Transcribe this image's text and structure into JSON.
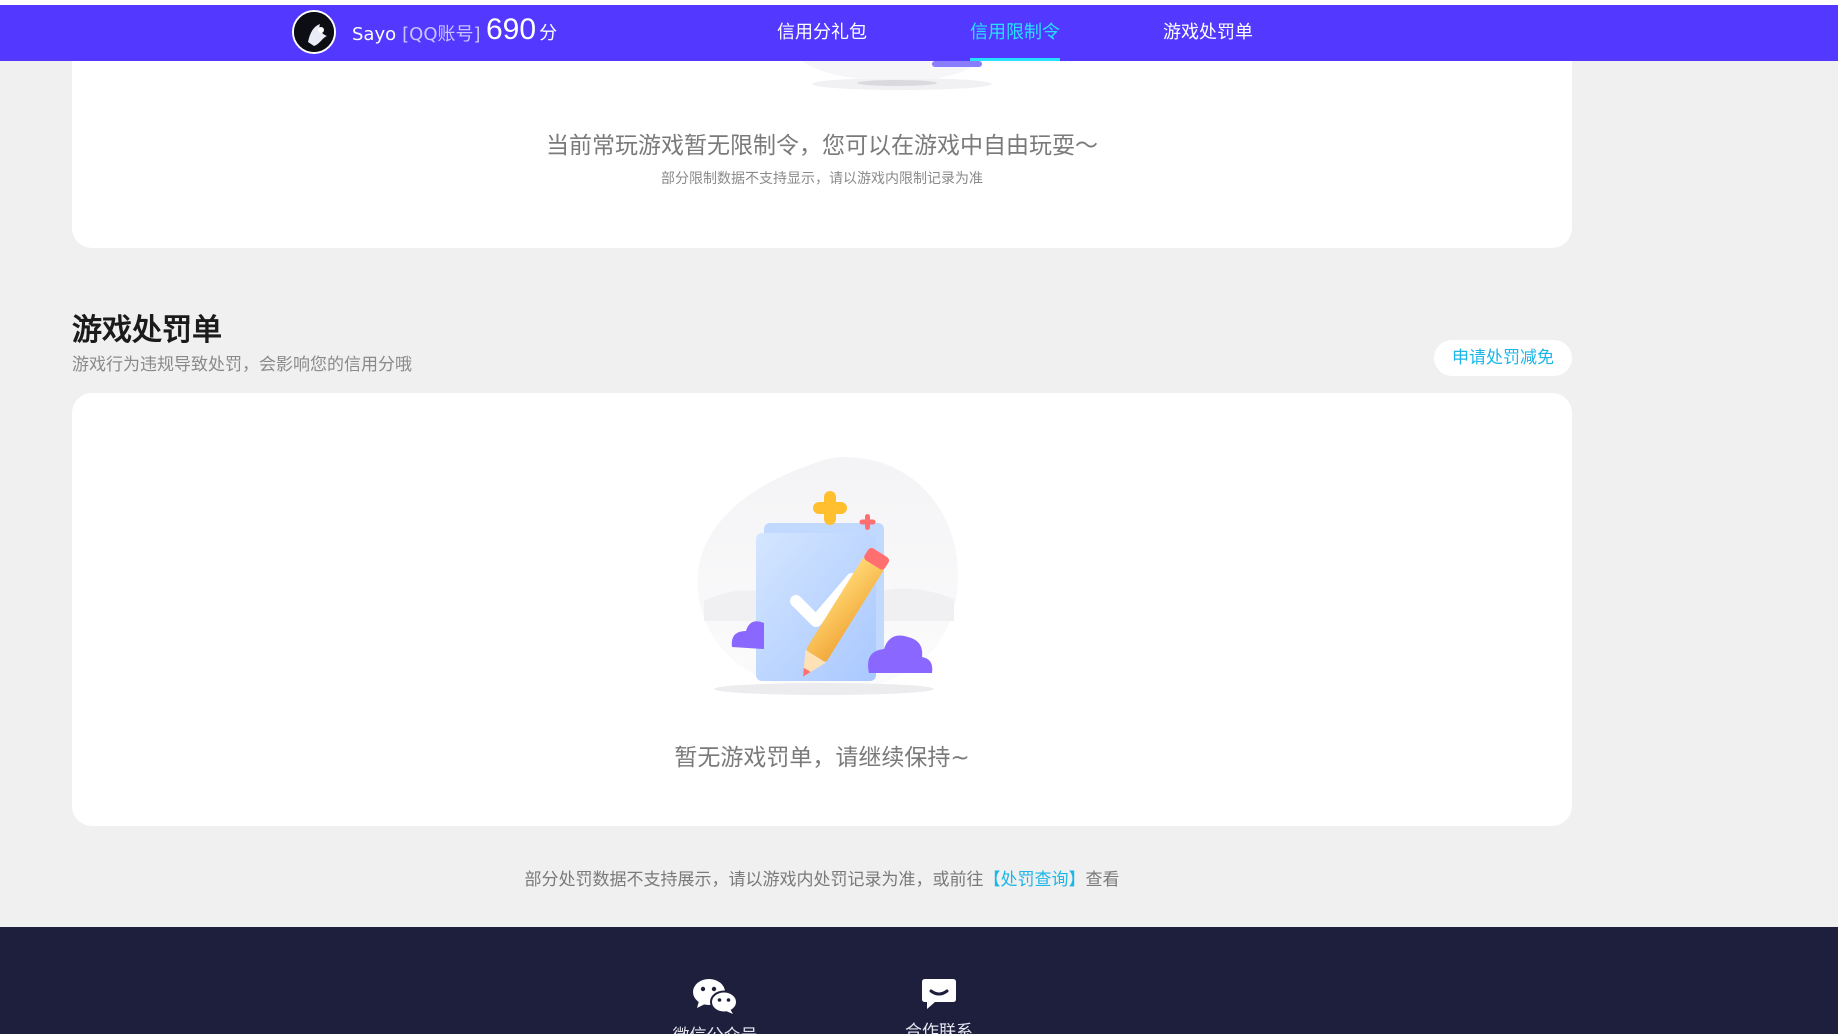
{
  "header": {
    "username": "Sayo",
    "account_type": "[QQ账号]",
    "score": "690",
    "score_unit": "分",
    "tabs": [
      {
        "label": "信用分礼包",
        "active": false
      },
      {
        "label": "信用限制令",
        "active": true
      },
      {
        "label": "游戏处罚单",
        "active": false
      }
    ]
  },
  "restriction_card": {
    "empty_text": "当前常玩游戏暂无限制令，您可以在游戏中自由玩耍～",
    "sub_text": "部分限制数据不支持显示，请以游戏内限制记录为准"
  },
  "penalty_section": {
    "title": "游戏处罚单",
    "description": "游戏行为违规导致处罚，会影响您的信用分哦",
    "apply_button": "申请处罚减免",
    "empty_text": "暂无游戏罚单，请继续保持~"
  },
  "footer_note": {
    "text_before": "部分处罚数据不支持展示，请以游戏内处罚记录为准，或前往",
    "link": "【处罚查询】",
    "text_after": "查看"
  },
  "footer": {
    "items": [
      {
        "label": "微信公众号",
        "icon": "wechat-icon"
      },
      {
        "label": "合作联系",
        "icon": "message-icon"
      }
    ]
  },
  "colors": {
    "primary": "#5338ff",
    "accent": "#25e3ff",
    "link": "#1cb6e8",
    "footer_bg": "#1d1f3d",
    "page_bg": "#f0f0f0"
  }
}
